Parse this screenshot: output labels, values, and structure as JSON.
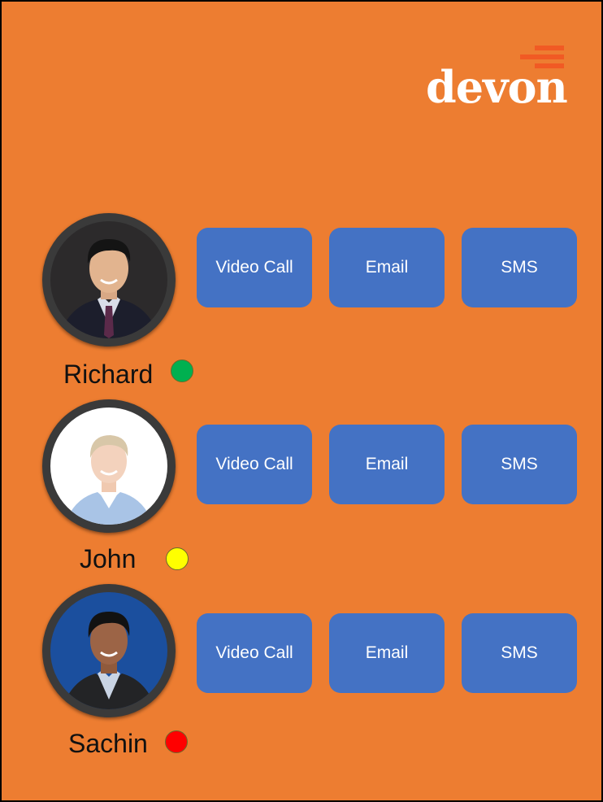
{
  "brand": {
    "logo_text": "devon",
    "logo_bar_color": "#F15A24"
  },
  "theme": {
    "background": "#ED7D31",
    "button_color": "#4472C4",
    "button_text_color": "#FFFFFF"
  },
  "contacts": [
    {
      "name": "Richard",
      "status_color": "#00B050",
      "buttons": {
        "video_call": "Video Call",
        "email": "Email",
        "sms": "SMS"
      }
    },
    {
      "name": "John",
      "status_color": "#FFFF00",
      "buttons": {
        "video_call": "Video Call",
        "email": "Email",
        "sms": "SMS"
      }
    },
    {
      "name": "Sachin",
      "status_color": "#FF0000",
      "buttons": {
        "video_call": "Video Call",
        "email": "Email",
        "sms": "SMS"
      }
    }
  ]
}
